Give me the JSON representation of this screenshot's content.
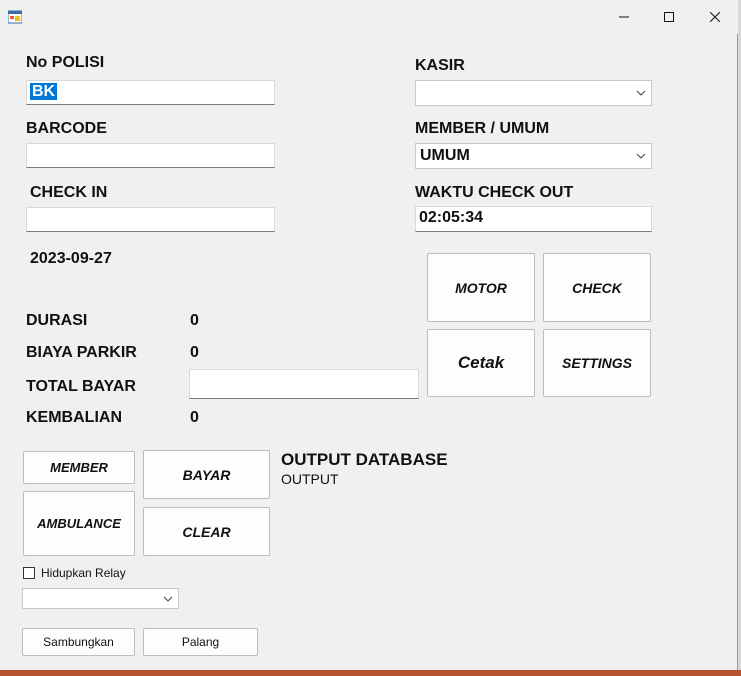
{
  "window": {
    "title": ""
  },
  "labels": {
    "no_polisi": "No POLISI",
    "barcode": "BARCODE",
    "check_in": "CHECK IN",
    "kasir": "KASIR",
    "member_umum": "MEMBER / UMUM",
    "waktu_check_out": "WAKTU CHECK OUT",
    "date": "2023-09-27",
    "durasi": "DURASI",
    "biaya_parkir": "BIAYA PARKIR",
    "total_bayar": "TOTAL BAYAR",
    "kembalian": "KEMBALIAN",
    "output_database": "OUTPUT DATABASE",
    "output": "OUTPUT",
    "hidupkan_relay": "Hidupkan Relay"
  },
  "values": {
    "no_polisi": "BK",
    "barcode": "",
    "check_in": "",
    "kasir": "",
    "member_umum": "UMUM",
    "waktu_check_out": "02:05:34",
    "durasi": "0",
    "biaya_parkir": "0",
    "total_bayar": "",
    "kembalian": "0",
    "relay_port": ""
  },
  "buttons": {
    "motor": "MOTOR",
    "check": "CHECK",
    "cetak": "Cetak",
    "settings": "SETTINGS",
    "member": "MEMBER",
    "bayar": "BAYAR",
    "ambulance": "AMBULANCE",
    "clear": "CLEAR",
    "sambungkan": "Sambungkan",
    "palang": "Palang"
  },
  "icons": {
    "app": "app-form-icon",
    "minimize": "minimize-icon",
    "maximize": "maximize-icon",
    "close": "close-icon",
    "dropdown": "chevron-down-icon"
  },
  "colors": {
    "selection": "#0078d7",
    "window_bg": "#f0f0f0"
  }
}
